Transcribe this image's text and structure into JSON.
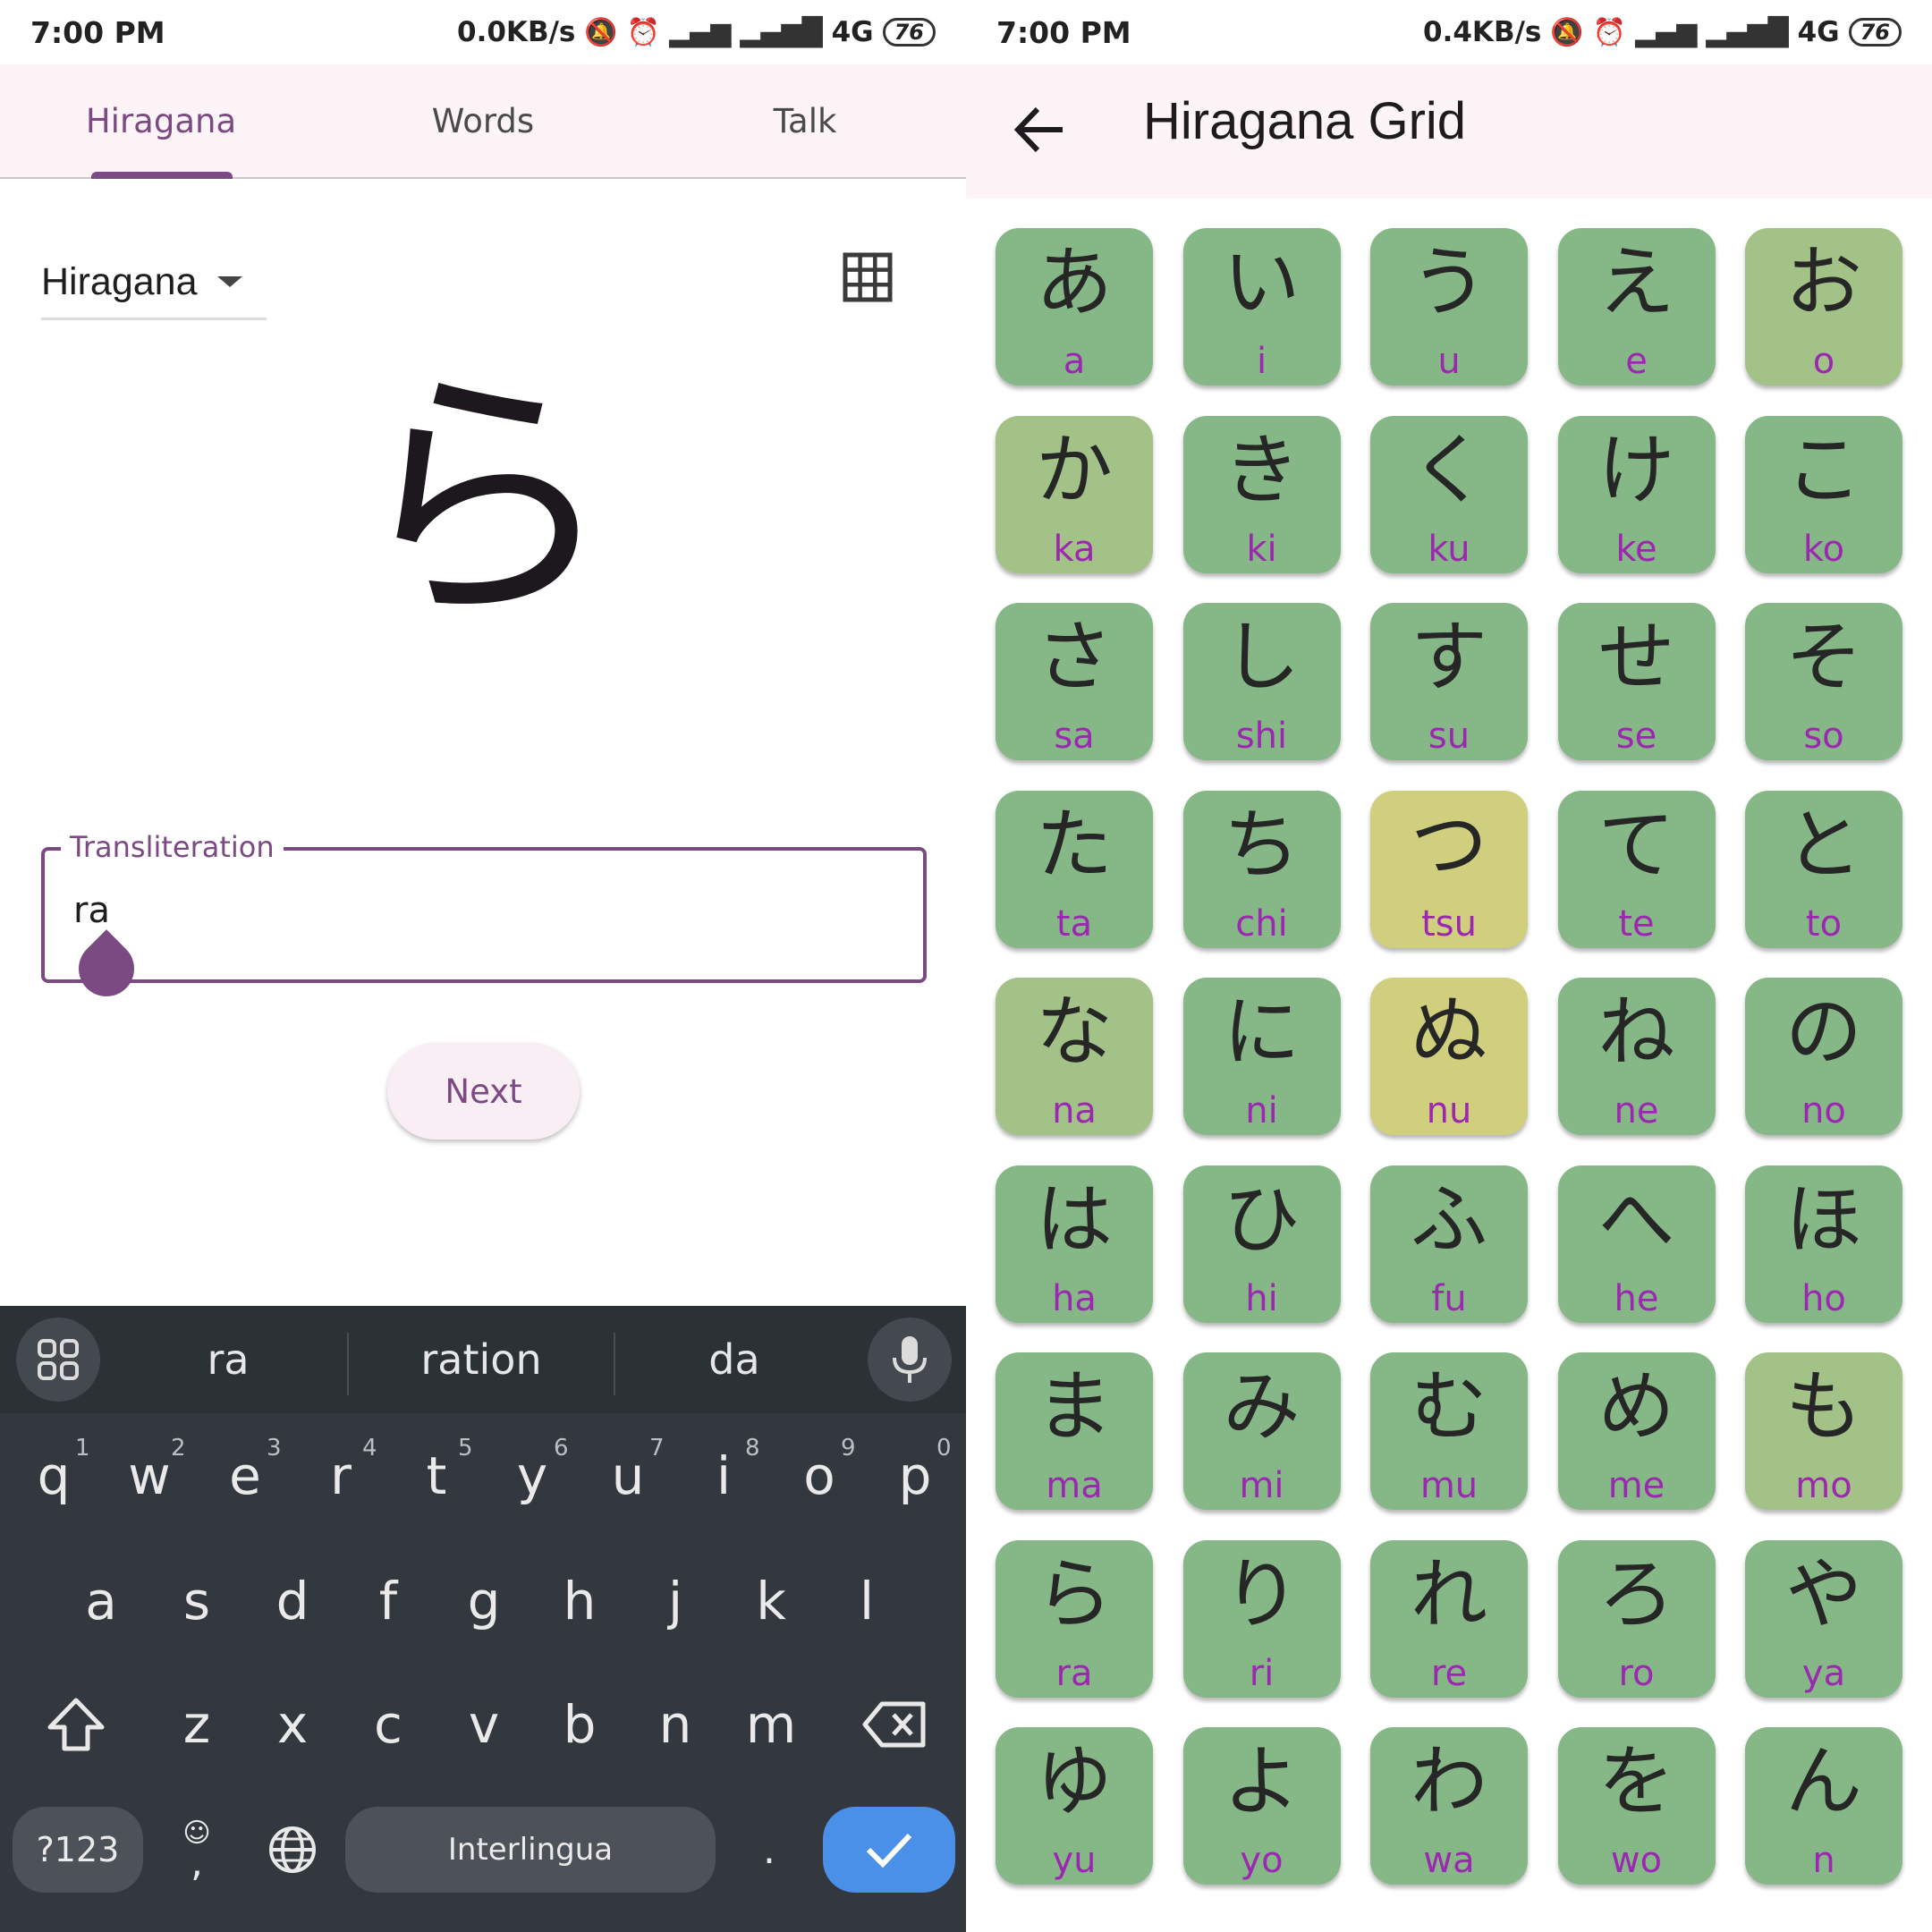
{
  "colors": {
    "accent": "#7b4a82",
    "header_bg": "#fdf4f8",
    "keyboard_bg": "#33383e",
    "check_button": "#4a8fe8",
    "cell_green": "#85b886",
    "cell_olive": "#a3c287",
    "cell_yellow": "#cfcf7e",
    "romaji": "#9c27b0"
  },
  "left": {
    "status": {
      "time": "7:00 PM",
      "speed": "0.0KB/s",
      "network": "4G",
      "battery": "76"
    },
    "tabs": [
      {
        "label": "Hiragana",
        "active": true
      },
      {
        "label": "Words",
        "active": false
      },
      {
        "label": "Talk",
        "active": false
      }
    ],
    "dropdown": {
      "value": "Hiragana",
      "icon": "chevron-down-icon"
    },
    "grid_icon": "grid-icon",
    "big_character": "ら",
    "input": {
      "label": "Transliteration",
      "value": "ra"
    },
    "next_label": "Next",
    "keyboard": {
      "suggestions": [
        "ra",
        "ration",
        "da"
      ],
      "row1": [
        "q",
        "w",
        "e",
        "r",
        "t",
        "y",
        "u",
        "i",
        "o",
        "p"
      ],
      "row1_numbers": [
        "1",
        "2",
        "3",
        "4",
        "5",
        "6",
        "7",
        "8",
        "9",
        "0"
      ],
      "row2": [
        "a",
        "s",
        "d",
        "f",
        "g",
        "h",
        "j",
        "k",
        "l"
      ],
      "row3": [
        "z",
        "x",
        "c",
        "v",
        "b",
        "n",
        "m"
      ],
      "symbols_label": "?123",
      "comma_label": ",",
      "period_label": ".",
      "space_label": "Interlingua"
    }
  },
  "right": {
    "status": {
      "time": "7:00 PM",
      "speed": "0.4KB/s",
      "network": "4G",
      "battery": "76"
    },
    "title": "Hiragana Grid",
    "back_icon": "arrow-left-icon",
    "grid": [
      [
        {
          "k": "あ",
          "r": "a",
          "c": "g"
        },
        {
          "k": "い",
          "r": "i",
          "c": "g"
        },
        {
          "k": "う",
          "r": "u",
          "c": "g"
        },
        {
          "k": "え",
          "r": "e",
          "c": "g"
        },
        {
          "k": "お",
          "r": "o",
          "c": "o"
        }
      ],
      [
        {
          "k": "か",
          "r": "ka",
          "c": "o"
        },
        {
          "k": "き",
          "r": "ki",
          "c": "g"
        },
        {
          "k": "く",
          "r": "ku",
          "c": "g"
        },
        {
          "k": "け",
          "r": "ke",
          "c": "g"
        },
        {
          "k": "こ",
          "r": "ko",
          "c": "g"
        }
      ],
      [
        {
          "k": "さ",
          "r": "sa",
          "c": "g"
        },
        {
          "k": "し",
          "r": "shi",
          "c": "g"
        },
        {
          "k": "す",
          "r": "su",
          "c": "g"
        },
        {
          "k": "せ",
          "r": "se",
          "c": "g"
        },
        {
          "k": "そ",
          "r": "so",
          "c": "g"
        }
      ],
      [
        {
          "k": "た",
          "r": "ta",
          "c": "g"
        },
        {
          "k": "ち",
          "r": "chi",
          "c": "g"
        },
        {
          "k": "つ",
          "r": "tsu",
          "c": "y"
        },
        {
          "k": "て",
          "r": "te",
          "c": "g"
        },
        {
          "k": "と",
          "r": "to",
          "c": "g"
        }
      ],
      [
        {
          "k": "な",
          "r": "na",
          "c": "o"
        },
        {
          "k": "に",
          "r": "ni",
          "c": "g"
        },
        {
          "k": "ぬ",
          "r": "nu",
          "c": "y"
        },
        {
          "k": "ね",
          "r": "ne",
          "c": "g"
        },
        {
          "k": "の",
          "r": "no",
          "c": "g"
        }
      ],
      [
        {
          "k": "は",
          "r": "ha",
          "c": "g"
        },
        {
          "k": "ひ",
          "r": "hi",
          "c": "g"
        },
        {
          "k": "ふ",
          "r": "fu",
          "c": "g"
        },
        {
          "k": "へ",
          "r": "he",
          "c": "g"
        },
        {
          "k": "ほ",
          "r": "ho",
          "c": "g"
        }
      ],
      [
        {
          "k": "ま",
          "r": "ma",
          "c": "g"
        },
        {
          "k": "み",
          "r": "mi",
          "c": "g"
        },
        {
          "k": "む",
          "r": "mu",
          "c": "g"
        },
        {
          "k": "め",
          "r": "me",
          "c": "g"
        },
        {
          "k": "も",
          "r": "mo",
          "c": "o"
        }
      ],
      [
        {
          "k": "ら",
          "r": "ra",
          "c": "g"
        },
        {
          "k": "り",
          "r": "ri",
          "c": "g"
        },
        {
          "k": "れ",
          "r": "re",
          "c": "g"
        },
        {
          "k": "ろ",
          "r": "ro",
          "c": "g"
        },
        {
          "k": "や",
          "r": "ya",
          "c": "g"
        }
      ],
      [
        {
          "k": "ゆ",
          "r": "yu",
          "c": "g"
        },
        {
          "k": "よ",
          "r": "yo",
          "c": "g"
        },
        {
          "k": "わ",
          "r": "wa",
          "c": "g"
        },
        {
          "k": "を",
          "r": "wo",
          "c": "g"
        },
        {
          "k": "ん",
          "r": "n",
          "c": "g"
        }
      ]
    ]
  }
}
